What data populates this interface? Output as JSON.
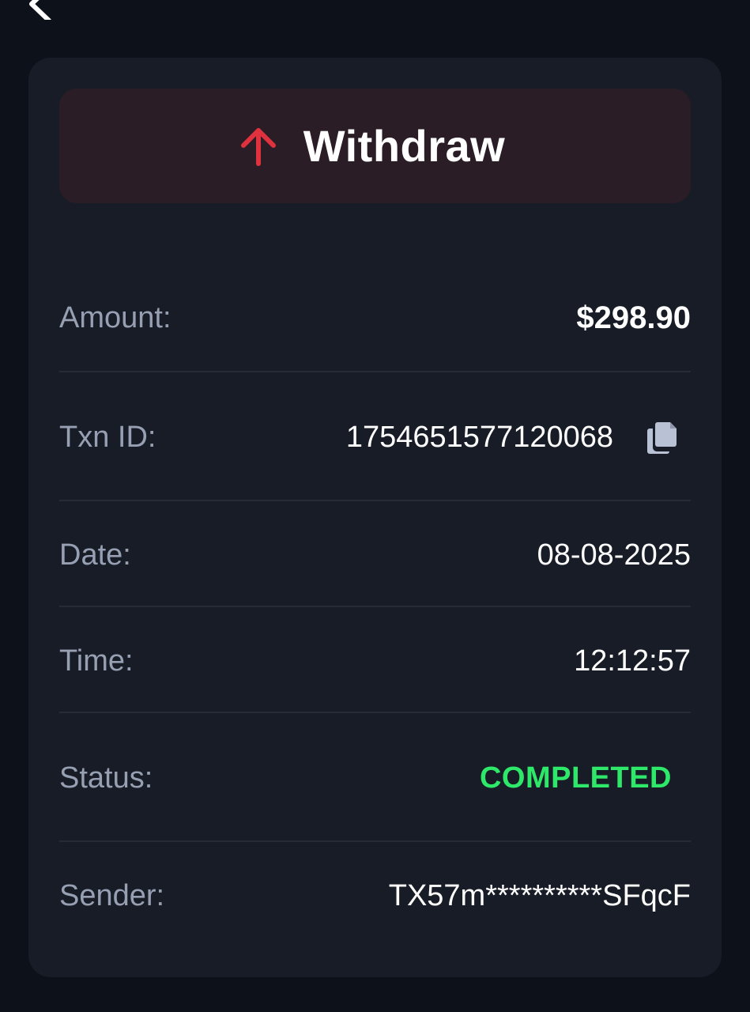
{
  "header": {
    "back_icon": "chevron-left-icon"
  },
  "transaction": {
    "type_label": "Withdraw",
    "type_icon": "arrow-up-icon",
    "type_color": "#e0313f",
    "amount_label": "Amount:",
    "amount_value": "$298.90",
    "txn_id_label": "Txn ID:",
    "txn_id_value": "1754651577120068",
    "copy_icon": "copy-icon",
    "date_label": "Date:",
    "date_value": "08-08-2025",
    "time_label": "Time:",
    "time_value": "12:12:57",
    "status_label": "Status:",
    "status_value": "COMPLETED",
    "status_color": "#2ee86a",
    "sender_label": "Sender:",
    "sender_value": "TX57m**********SFqcF"
  }
}
